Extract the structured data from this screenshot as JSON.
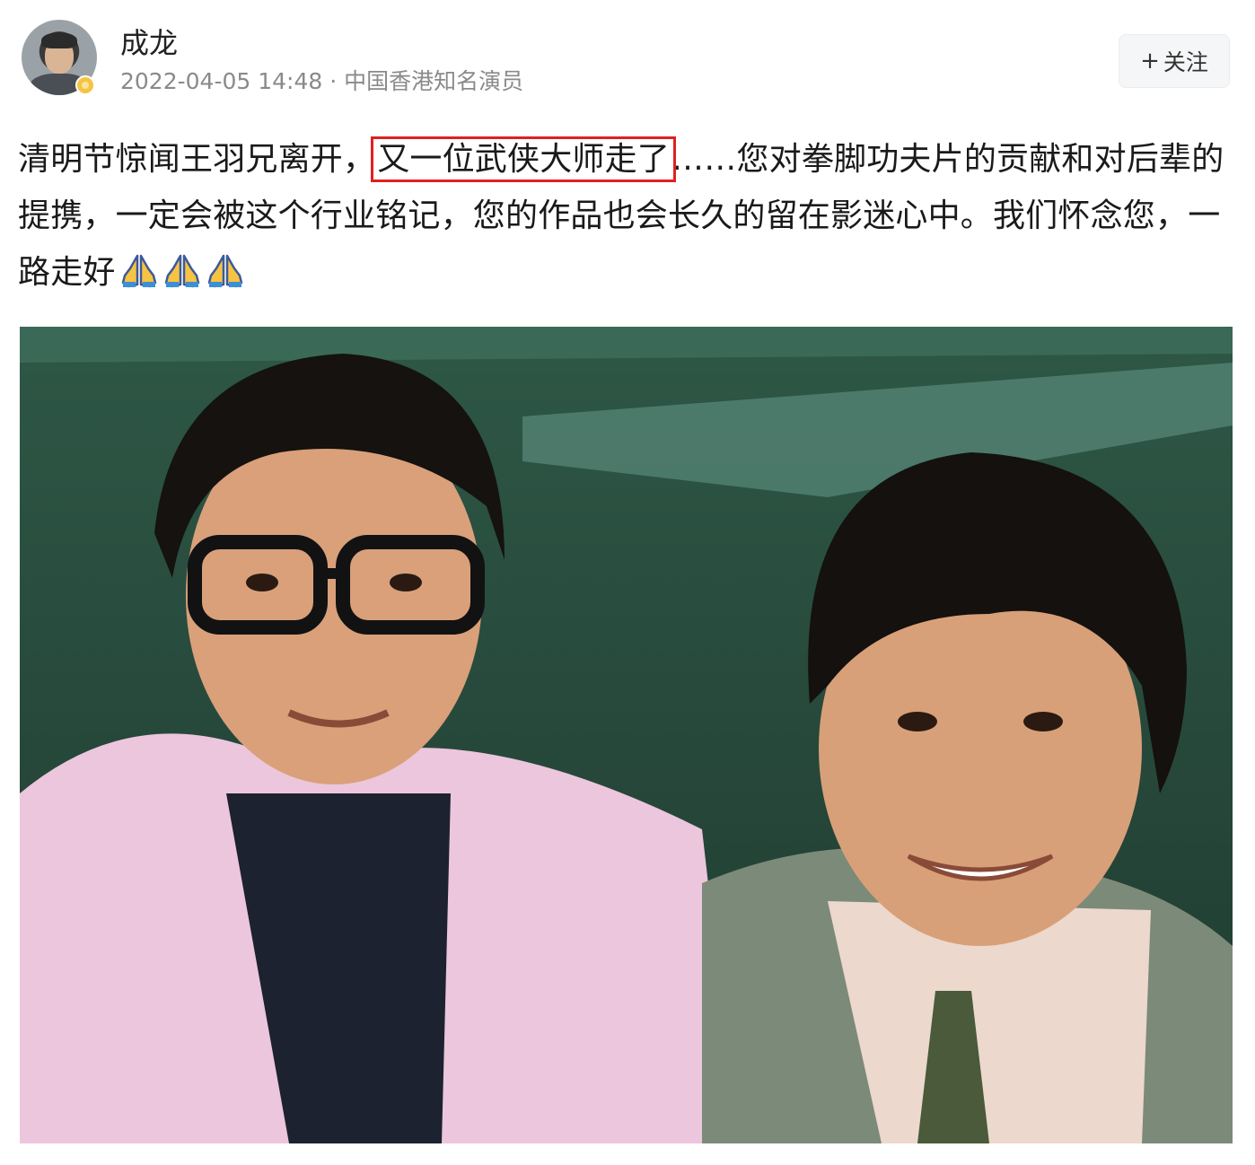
{
  "author": {
    "name": "成龙",
    "timestamp": "2022-04-05 14:48",
    "separator": "·",
    "description": "中国香港知名演员"
  },
  "follow_button": {
    "label": "关注"
  },
  "post": {
    "text_before": "清明节惊闻王羽兄离开，",
    "text_highlight": "又一位武侠大师走了",
    "text_after": "……您对拳脚功夫片的贡献和对后辈的提携，一定会被这个行业铭记，您的作品也会长久的留在影迷心中。我们怀念您，一路走好",
    "emoji_names": [
      "folded-hands-icon",
      "folded-hands-icon",
      "folded-hands-icon"
    ],
    "highlight_color": "#e02020"
  },
  "photo": {
    "description_icon": "photo-two-men"
  }
}
